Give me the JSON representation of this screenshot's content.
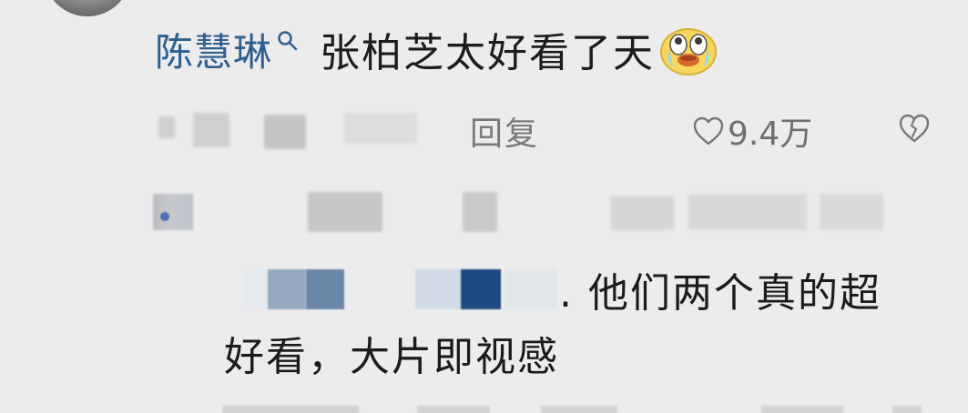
{
  "comment": {
    "user": {
      "name": "陈慧琳"
    },
    "text": "张柏芝太好看了天",
    "emoji": "crying-laughing-face-icon",
    "actions": {
      "reply_label": "回复",
      "likes": "9.4万"
    }
  },
  "reply": {
    "text_line_1": ". 他们两个真的超",
    "text_line_2": "好看，大片即视感"
  },
  "icons": {
    "search": "search-icon",
    "heart": "heart-icon",
    "dislike": "broken-heart-icon"
  },
  "colors": {
    "background": "#ececec",
    "username": "#2f5f90",
    "text": "#1c1c1c",
    "meta": "#7a7a7a"
  }
}
